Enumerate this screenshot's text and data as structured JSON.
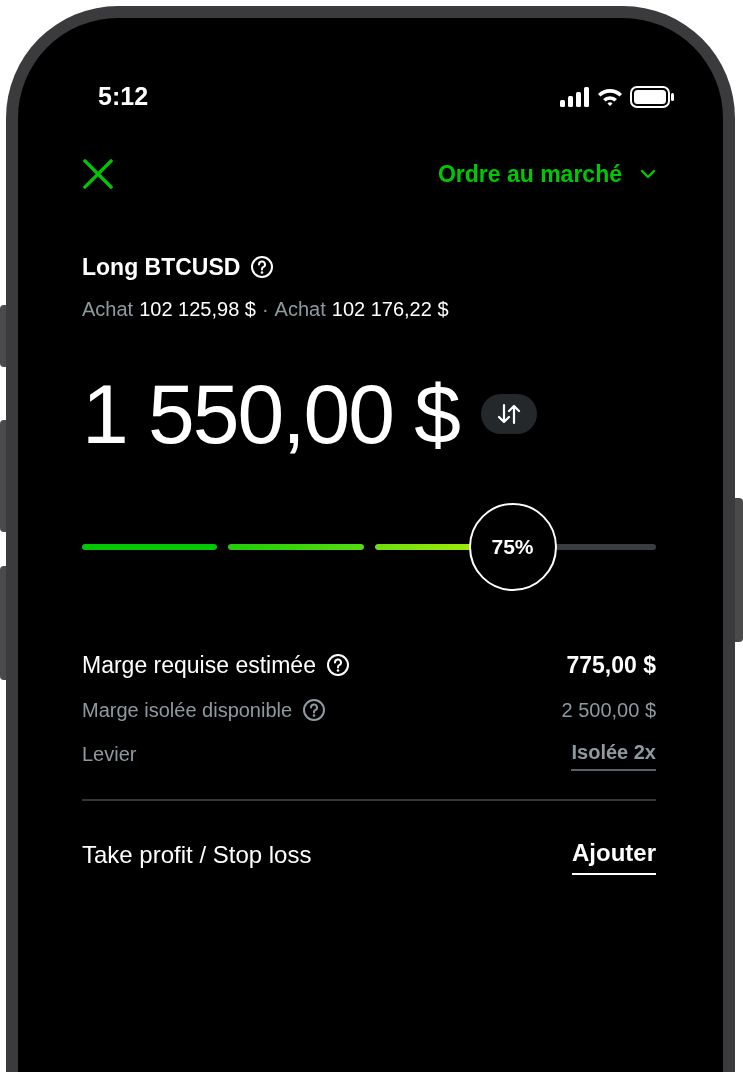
{
  "status_bar": {
    "time": "5:12"
  },
  "header": {
    "order_type": "Ordre au marché"
  },
  "position": {
    "title": "Long BTCUSD",
    "separator": "·",
    "prices": [
      {
        "label": "Achat",
        "value": "102 125,98 $"
      },
      {
        "label": "Achat",
        "value": "102 176,22 $"
      }
    ]
  },
  "amount": "1 550,00 $",
  "slider": {
    "level": 0.75,
    "reading": "75%"
  },
  "details": [
    {
      "label": "Marge requise estimée",
      "value": "775,00 $",
      "kind": "primary",
      "info": true
    },
    {
      "label": "Marge isolée disponible",
      "value": "2 500,00 $",
      "kind": "secondary",
      "info": true
    },
    {
      "label": "Levier",
      "value": "Isolée 2x",
      "kind": "link",
      "info": false
    }
  ],
  "take_profit": {
    "label": "Take profit / Stop loss",
    "action": "Ajouter"
  }
}
